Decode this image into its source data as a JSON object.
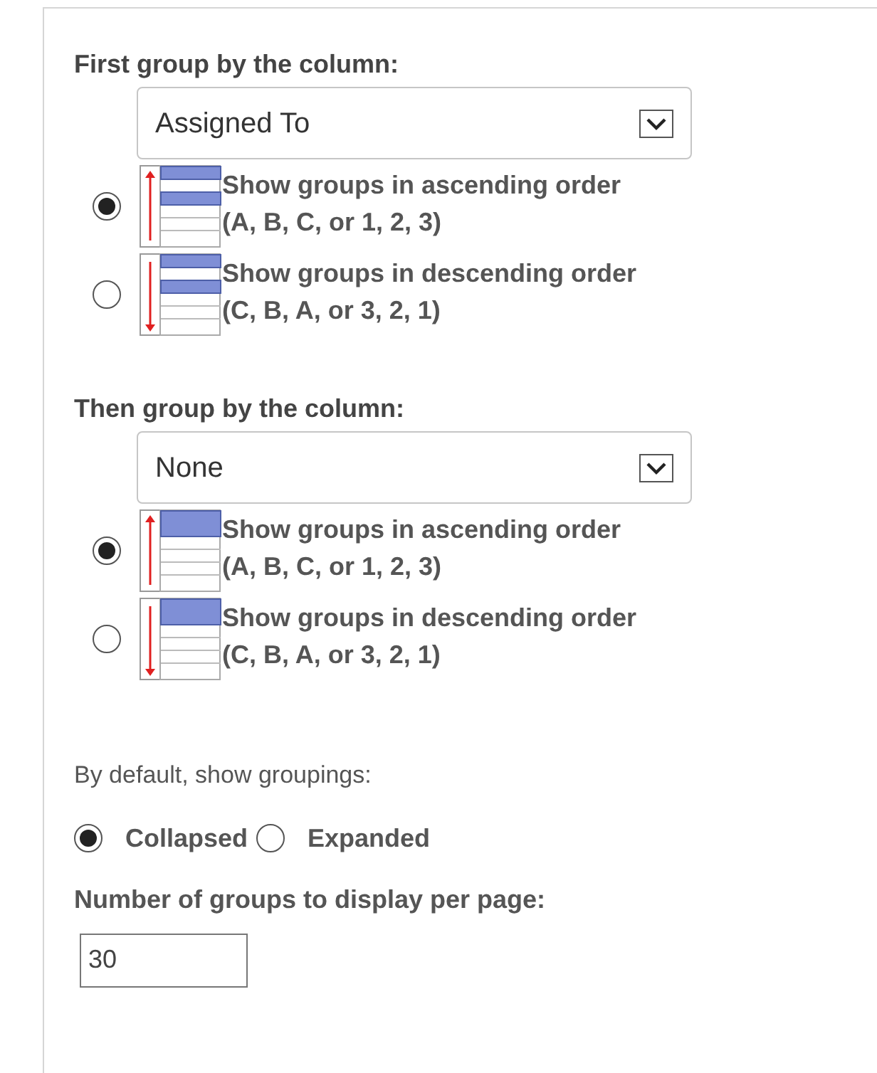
{
  "groups": [
    {
      "heading": "First group by the column:",
      "select": {
        "value": "Assigned To"
      },
      "options": [
        {
          "kind": "ascending",
          "line1": "Show groups in ascending order",
          "line2": "(A, B, C, or 1, 2, 3)",
          "selected": true
        },
        {
          "kind": "descending",
          "line1": "Show groups in descending order",
          "line2": "(C, B, A, or 3, 2, 1)",
          "selected": false
        }
      ]
    },
    {
      "heading": "Then group by the column:",
      "select": {
        "value": "None"
      },
      "options": [
        {
          "kind": "ascending",
          "line1": "Show groups in ascending order",
          "line2": "(A, B, C, or 1, 2, 3)",
          "selected": true
        },
        {
          "kind": "descending",
          "line1": "Show groups in descending order",
          "line2": "(C, B, A, or 3, 2, 1)",
          "selected": false
        }
      ]
    }
  ],
  "default_groupings": {
    "label": "By default, show groupings:",
    "options": [
      {
        "label": "Collapsed",
        "selected": true
      },
      {
        "label": "Expanded",
        "selected": false
      }
    ]
  },
  "groups_per_page": {
    "label": "Number of groups to display per page:",
    "value": "30"
  }
}
